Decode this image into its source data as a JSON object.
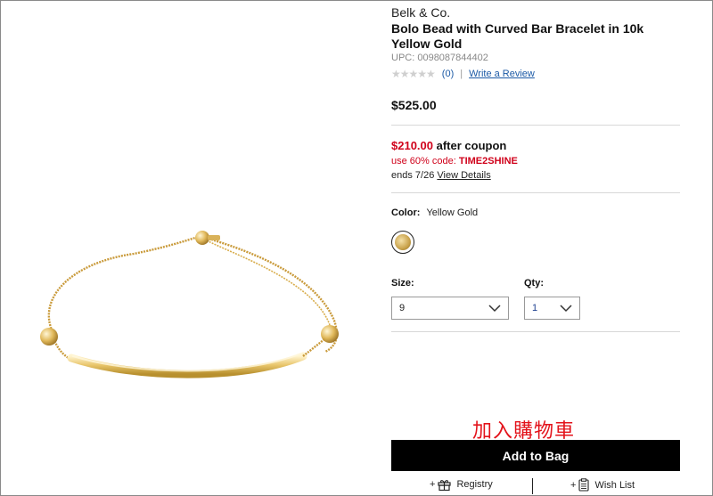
{
  "product": {
    "brand": "Belk & Co.",
    "title": "Bolo Bead with Curved Bar Bracelet in 10k Yellow Gold",
    "upc": "UPC: 0098087844402",
    "rating_stars": "★★★★★",
    "review_count": "(0)",
    "rating_separator": "|",
    "write_review": "Write a Review",
    "price": "$525.00"
  },
  "coupon": {
    "price": "$210.00",
    "after": "after coupon",
    "code_prefix": "use 60% code:",
    "code": "TIME2SHINE",
    "ends": "ends 7/26",
    "details_link": "View Details"
  },
  "color": {
    "label": "Color:",
    "value": "Yellow Gold"
  },
  "size": {
    "label": "Size:",
    "value": "9"
  },
  "qty": {
    "label": "Qty:",
    "value": "1"
  },
  "annotation": "加入購物車",
  "actions": {
    "add_to_bag": "Add to Bag",
    "plus": "+",
    "registry": "Registry",
    "wish_list": "Wish List"
  },
  "colors": {
    "sale_red": "#d0021b",
    "link_blue": "#1c5aa6",
    "button_black": "#000000",
    "annotation_red": "#e3131b"
  }
}
